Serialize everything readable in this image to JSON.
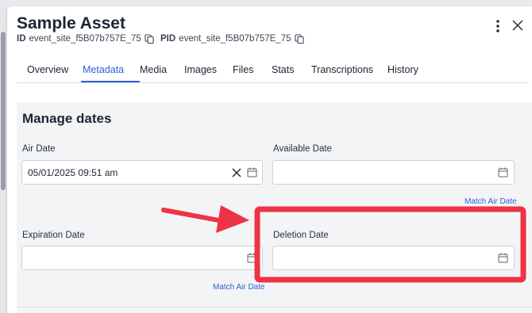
{
  "header": {
    "title": "Sample Asset",
    "id_label": "ID",
    "id_value": "event_site_f5B07b757E_75",
    "pid_label": "PID",
    "pid_value": "event_site_f5B07b757E_75"
  },
  "tabs": [
    {
      "label": "Overview"
    },
    {
      "label": "Metadata"
    },
    {
      "label": "Media"
    },
    {
      "label": "Images"
    },
    {
      "label": "Files"
    },
    {
      "label": "Stats"
    },
    {
      "label": "Transcriptions"
    },
    {
      "label": "History"
    }
  ],
  "active_tab": "Metadata",
  "section": {
    "title": "Manage dates",
    "air_date": {
      "label": "Air Date",
      "value": "05/01/2025 09:51 am"
    },
    "available_date": {
      "label": "Available Date",
      "value": "",
      "match_link": "Match Air Date"
    },
    "expiration_date": {
      "label": "Expiration Date",
      "value": "",
      "match_link": "Match Air Date"
    },
    "deletion_date": {
      "label": "Deletion Date",
      "value": ""
    }
  },
  "annotation": {
    "arrow_color": "#ee3344",
    "highlight_color": "#ee3344"
  },
  "colors": {
    "accent": "#2b64d1",
    "text": "#1c2434",
    "content_bg": "#f3f4f6"
  }
}
